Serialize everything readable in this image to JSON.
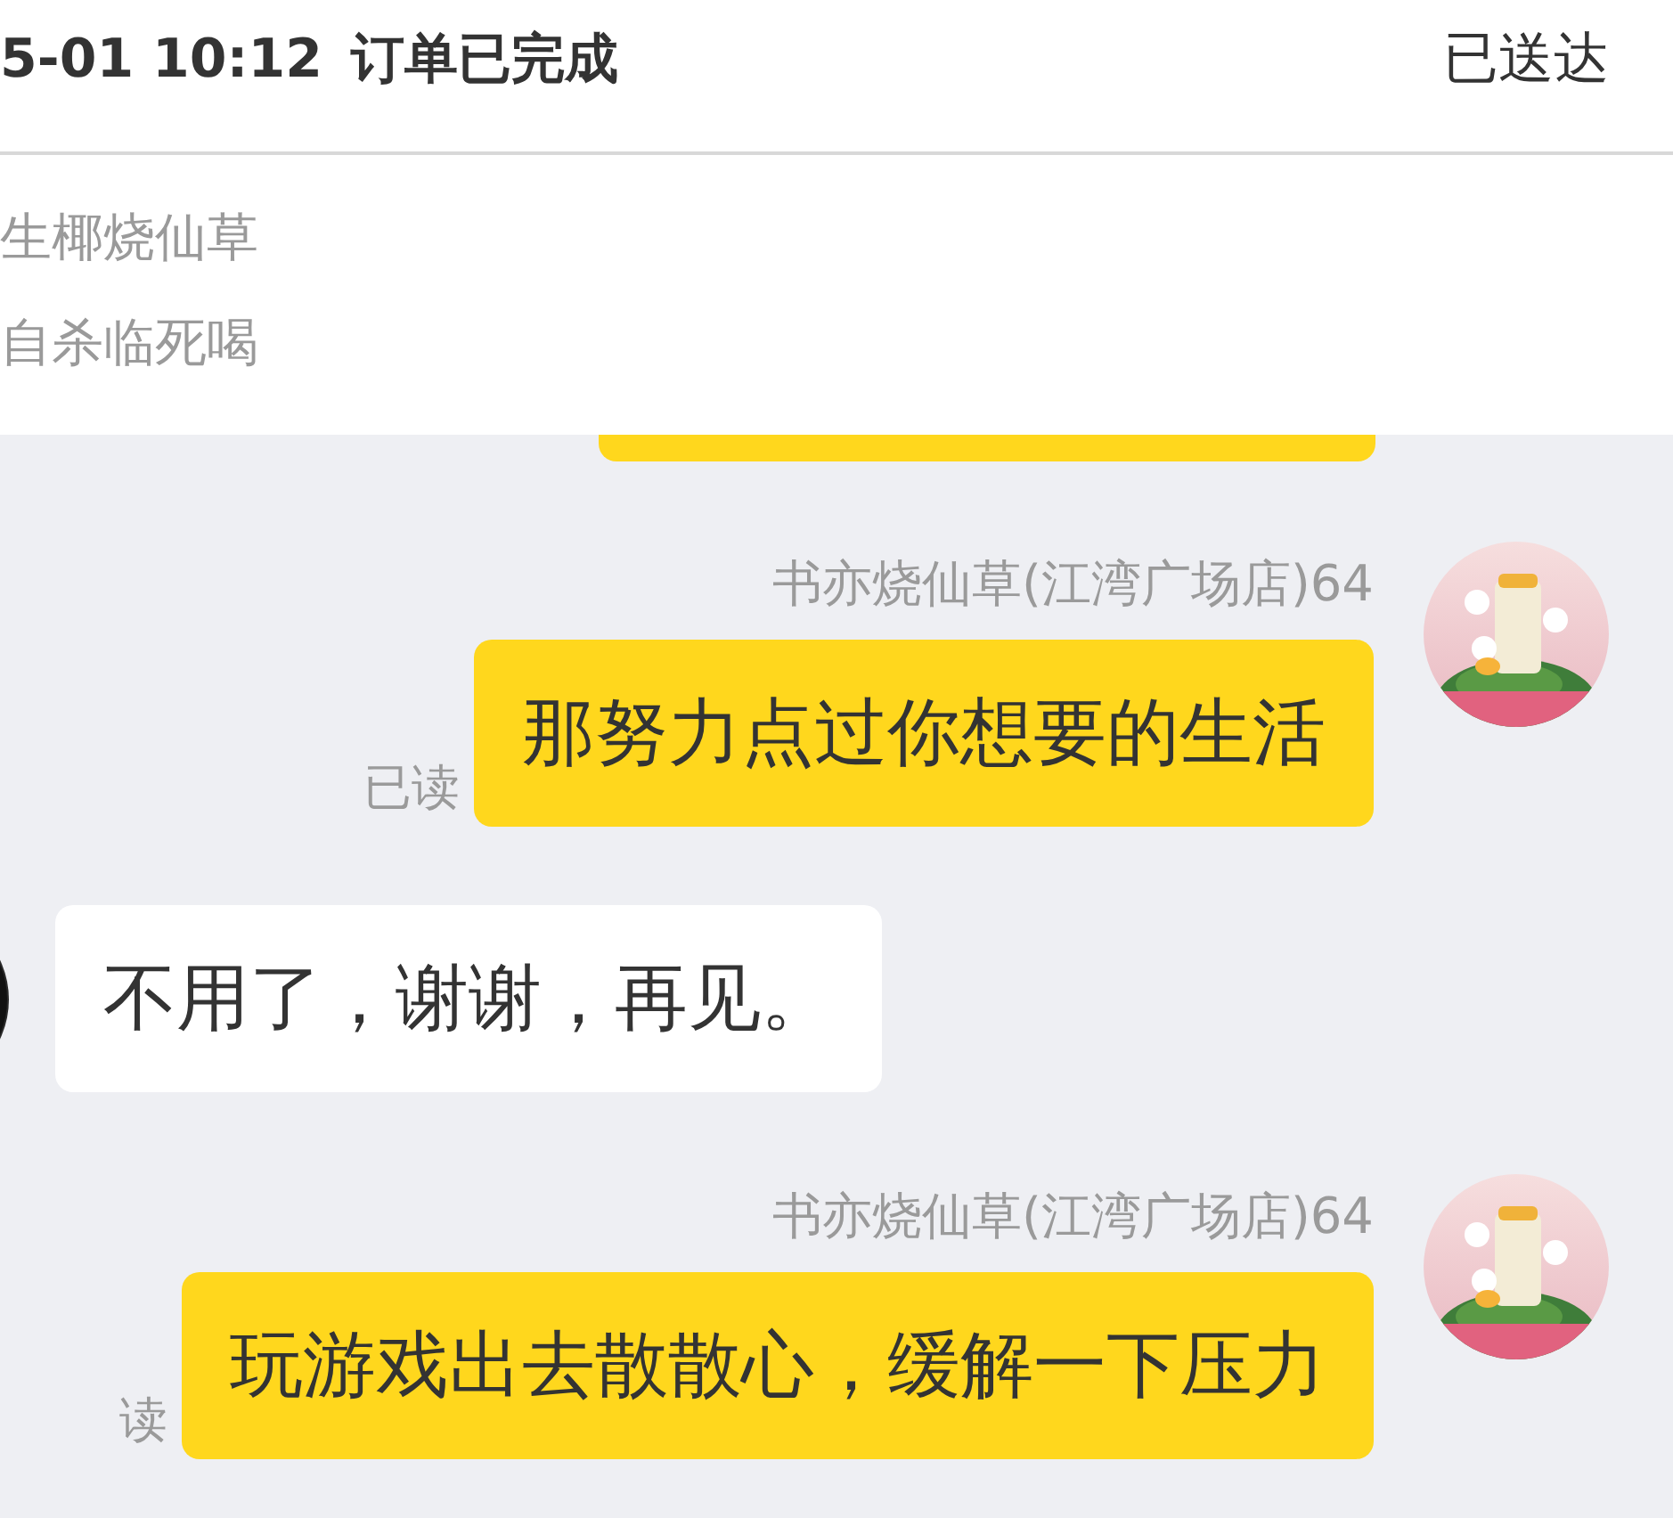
{
  "order_header": {
    "time": "5-01 10:12",
    "status": "订单已完成",
    "delivery_status": "已送达"
  },
  "order_items": [
    "生椰烧仙草",
    "自杀临死喝"
  ],
  "messages": [
    {
      "kind": "clipped"
    },
    {
      "kind": "outgoing",
      "sender": "书亦烧仙草(江湾广场店)64",
      "text": "那努力点过你想要的生活",
      "read_label": "已读"
    },
    {
      "kind": "incoming",
      "text": "不用了，谢谢，再见。"
    },
    {
      "kind": "outgoing",
      "sender": "书亦烧仙草(江湾广场店)64",
      "text": "玩游戏出去散散心，缓解一下压力",
      "read_label": "读"
    }
  ]
}
